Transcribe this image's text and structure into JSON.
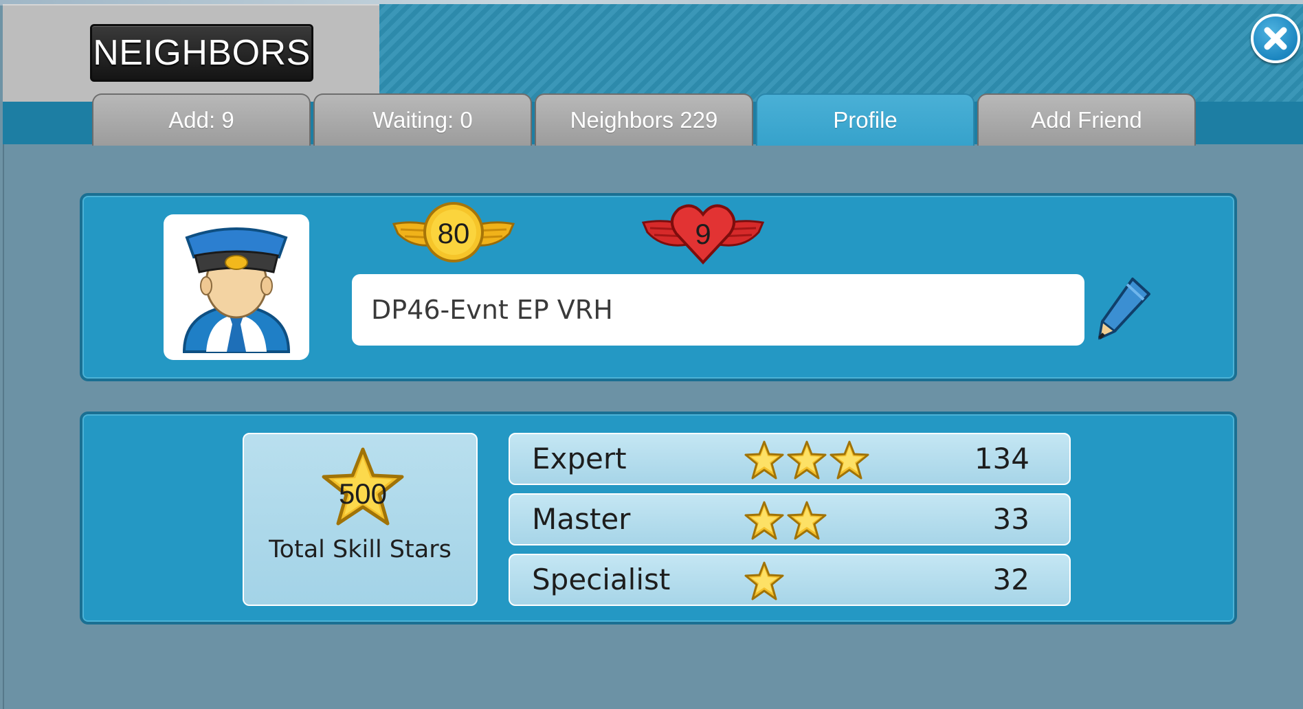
{
  "header": {
    "title": "NEIGHBORS",
    "close_icon": "close-icon"
  },
  "tabs": [
    {
      "label": "Add: 9",
      "active": false
    },
    {
      "label": "Waiting: 0",
      "active": false
    },
    {
      "label": "Neighbors 229",
      "active": false
    },
    {
      "label": "Profile",
      "active": true
    },
    {
      "label": "Add Friend",
      "active": false
    }
  ],
  "profile": {
    "avatar_icon": "conductor-avatar-icon",
    "level": "80",
    "hearts": "9",
    "name": "DP46-Evnt EP VRH",
    "edit_icon": "pencil-icon"
  },
  "skills": {
    "total_value": "500",
    "total_label": "Total Skill Stars",
    "rows": [
      {
        "name": "Expert",
        "stars": 3,
        "count": "134"
      },
      {
        "name": "Master",
        "stars": 2,
        "count": "33"
      },
      {
        "name": "Specialist",
        "stars": 1,
        "count": "32"
      }
    ]
  },
  "colors": {
    "panel": "#2498c4",
    "tab_active": "#3ca6cf",
    "tab_inactive": "#a9a9a9",
    "background": "#6c92a5"
  }
}
